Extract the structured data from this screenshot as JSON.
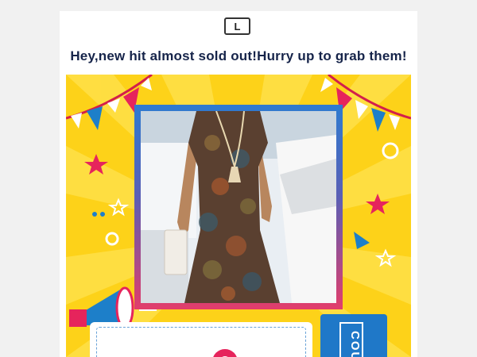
{
  "brand": {
    "logo_letter": "L"
  },
  "headline": "Hey,new hit almost sold out!Hurry up to grab them!",
  "banner": {
    "background_color": "#fdd219",
    "frame_gradient": [
      "#2e7bd0",
      "#e23d6b"
    ],
    "product_image": "paisley-print-maxi-dress-photo",
    "coupon_label": "COU"
  },
  "colors": {
    "headline": "#16244a",
    "flag_red": "#e6245c",
    "flag_blue": "#1d7fc9",
    "coupon_blue": "#1f78c8"
  }
}
